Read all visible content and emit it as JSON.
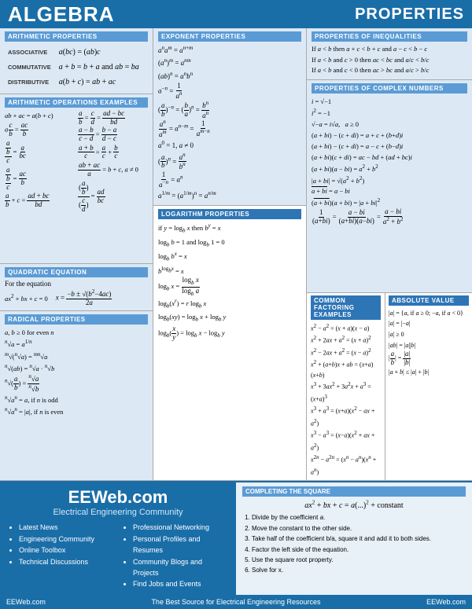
{
  "header": {
    "algebra_label": "ALGEBRA",
    "properties_label": "PROPERTIES"
  },
  "sections": {
    "arithmetic_properties": {
      "title": "ARITHMETIC PROPERTIES",
      "associative_label": "ASSOCIATIVE",
      "associative_formula": "a(bc) = (ab)c",
      "commutative_label": "COMMUTATIVE",
      "commutative_formula": "a + b = b + a and ab = ba",
      "distributive_label": "DISTRIBUTIVE",
      "distributive_formula": "a(b + c) = ab + ac"
    },
    "arithmetic_operations": {
      "title": "ARITHMETIC OPERATIONS EXAMPLES"
    },
    "exponent_properties": {
      "title": "EXPONENT PROPERTIES"
    },
    "inequalities": {
      "title": "PROPERTIES OF INEQUALITIES"
    },
    "complex_numbers": {
      "title": "PROPERTIES OF COMPLEX NUMBERS"
    },
    "quadratic": {
      "title": "QUADRATIC EQUATION",
      "subtitle": "For the equation",
      "equation": "ax² + bx + c = 0",
      "formula": "x = (−b ± √(b²−4ac)) / 2a"
    },
    "radical": {
      "title": "RADICAL PROPERTIES"
    },
    "logarithm": {
      "title": "LOGARITHM PROPERTIES"
    },
    "factoring": {
      "title": "COMMON FACTORING EXAMPLES"
    },
    "absolute_value": {
      "title": "ABSOLUTE VALUE"
    },
    "completing_square": {
      "title": "COMPLETING THE SQUARE",
      "formula": "ax² + bx + c = a(...)² + constant",
      "steps": [
        "Divide by the coefficient a.",
        "Move the constant to the other side.",
        "Take half of the coefficient b/a, square it and add it to both sides.",
        "Factor the left side of the equation.",
        "Use the square root property.",
        "Solve for x."
      ]
    }
  },
  "footer": {
    "left": "EEWeb.com",
    "center": "The Best Source for Electrical Engineering Resources",
    "right": "EEWeb.com"
  },
  "bottom": {
    "site_name": "EEWeb.com",
    "tagline": "Electrical Engineering Community",
    "list1": [
      "Latest News",
      "Engineering Community",
      "Online Toolbox",
      "Technical Discussions"
    ],
    "list2": [
      "Professional Networking",
      "Personal Profiles and Resumes",
      "Community Blogs and Projects",
      "Find Jobs and Events"
    ]
  }
}
